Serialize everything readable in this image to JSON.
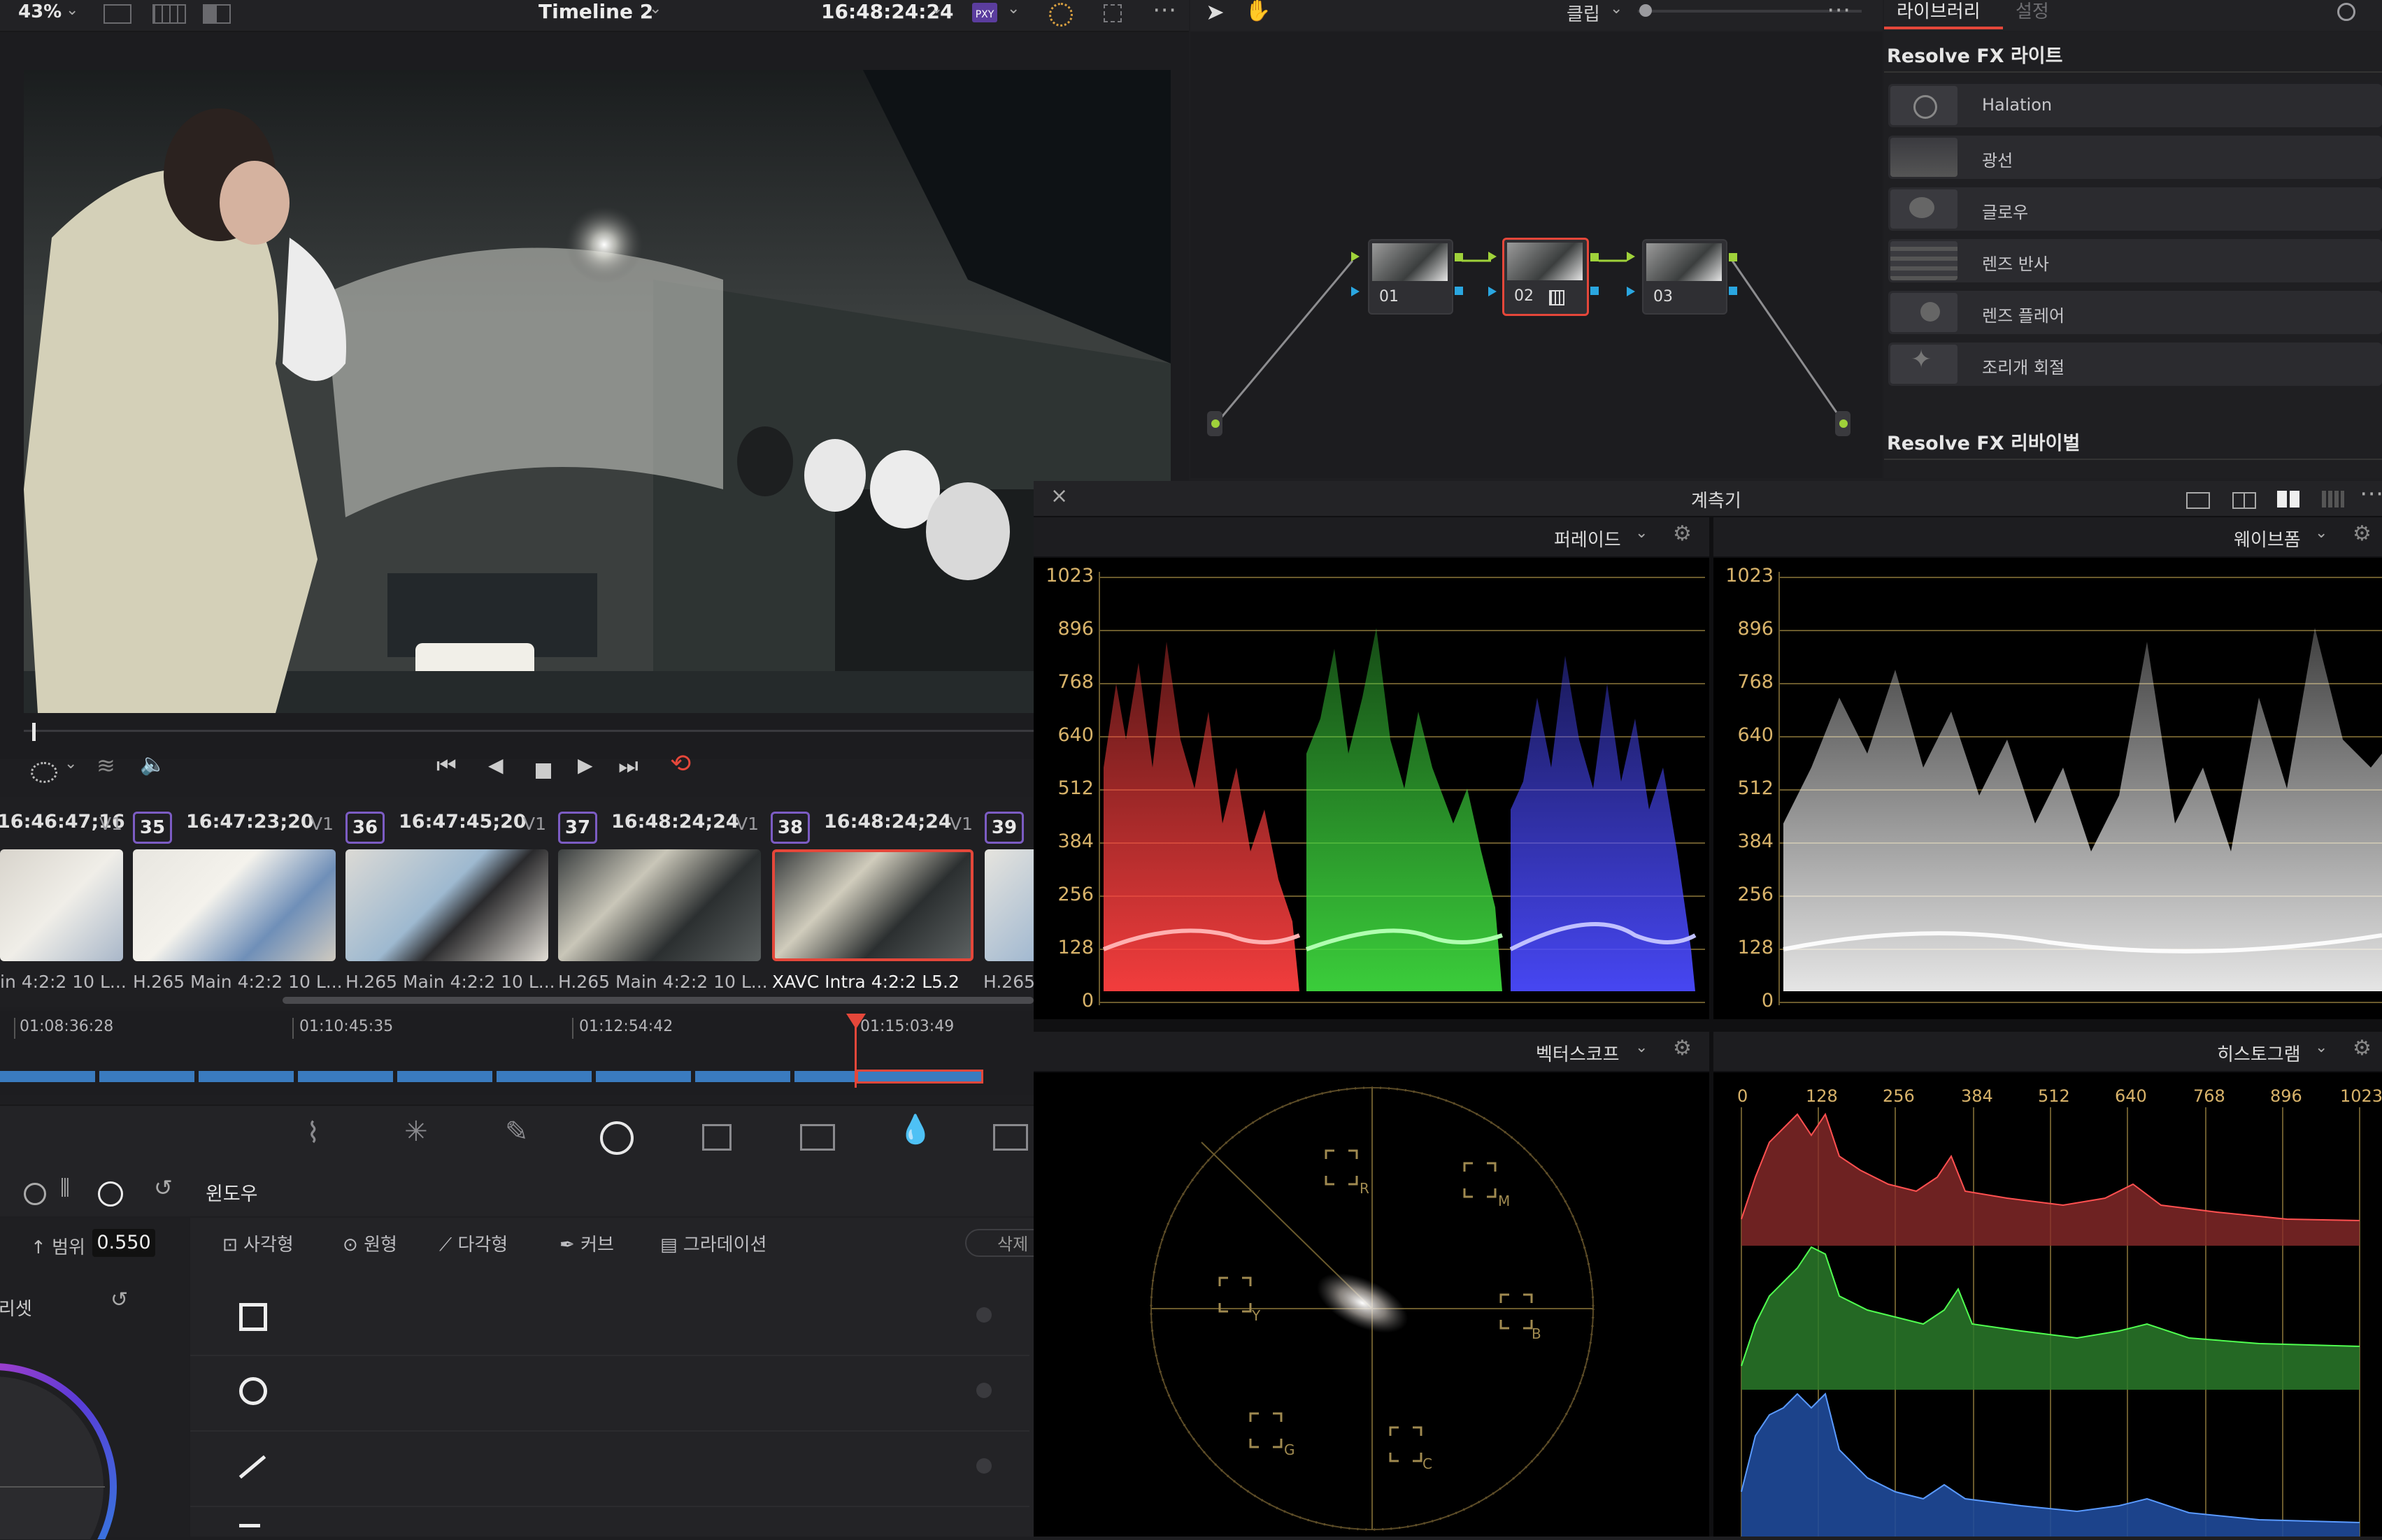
{
  "viewer": {
    "zoom": "43%",
    "timeline_name": "Timeline 2",
    "timecode": "16:48:24:24",
    "badge": "PXY"
  },
  "node_editor": {
    "mode": "클립",
    "nodes": [
      {
        "label": "01"
      },
      {
        "label": "02"
      },
      {
        "label": "03"
      }
    ]
  },
  "library": {
    "tabs": [
      "라이브러리",
      "설정"
    ],
    "section_light": "Resolve FX 라이트",
    "effects": [
      "Halation",
      "광선",
      "글로우",
      "렌즈 반사",
      "렌즈 플레어",
      "조리개 회절"
    ],
    "section_revival": "Resolve FX 리바이벌"
  },
  "timeline_strip": {
    "clips": [
      {
        "tc": "16:46:47;16",
        "track": "V1",
        "num": "35",
        "codec": "in 4:2:2 10 L..."
      },
      {
        "tc": "16:47:23;20",
        "track": "V1",
        "num": "36",
        "codec": "H.265 Main 4:2:2 10 L..."
      },
      {
        "tc": "16:47:45;20",
        "track": "V1",
        "num": "37",
        "codec": "H.265 Main 4:2:2 10 L..."
      },
      {
        "tc": "16:48:24;24",
        "track": "V1",
        "num": "38",
        "codec": "H.265 Main 4:2:2 10 L..."
      },
      {
        "tc": "16:48:24;24",
        "track": "V1",
        "num": "39",
        "codec": "XAVC Intra 4:2:2 L5.2"
      },
      {
        "tc": "",
        "track": "",
        "num": "",
        "codec": "H.265"
      }
    ],
    "ruler": [
      "01:08:36:28",
      "01:10:45:35",
      "01:12:54:42",
      "01:15:03:49"
    ]
  },
  "window_panel": {
    "title": "윈도우",
    "range_label": "범위",
    "range_value": "0.550",
    "preset_label": "프리셋",
    "tools": [
      "사각형",
      "원형",
      "다각형",
      "커브",
      "그라데이션"
    ],
    "delete_label": "삭제"
  },
  "scopes": {
    "title": "계측기",
    "parade": {
      "label": "퍼레이드",
      "yticks": [
        "1023",
        "896",
        "768",
        "640",
        "512",
        "384",
        "256",
        "128",
        "0"
      ]
    },
    "waveform": {
      "label": "웨이브폼",
      "yticks": [
        "1023",
        "896",
        "768",
        "640",
        "512",
        "384",
        "256",
        "128",
        "0"
      ]
    },
    "vectorscope": {
      "label": "벡터스코프",
      "targets": [
        "R",
        "M",
        "Y",
        "B",
        "G",
        "C"
      ]
    },
    "histogram": {
      "label": "히스토그램",
      "xticks": [
        "0",
        "128",
        "256",
        "384",
        "512",
        "640",
        "768",
        "896",
        "1023"
      ]
    }
  },
  "colors": {
    "accent_red": "#e5473a",
    "node_green": "#9fd23a",
    "node_blue": "#2aa6e0",
    "scope_gold": "#d8b36a"
  }
}
